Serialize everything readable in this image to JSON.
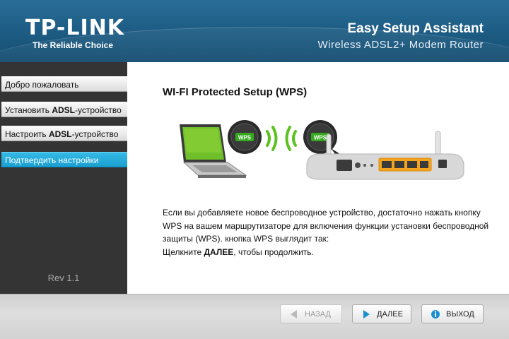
{
  "header": {
    "brand": "TP-LINK",
    "tagline": "The Reliable Choice",
    "title": "Easy Setup Assistant",
    "subtitle": "Wireless ADSL2+ Modem Router"
  },
  "sidebar": {
    "items": [
      {
        "label": "Добро пожаловать",
        "bold": "",
        "active": false
      },
      {
        "label": "Установить ",
        "bold": "ADSL",
        "suffix": "-устройство",
        "active": false
      },
      {
        "label": "Настроить ",
        "bold": "ADSL",
        "suffix": "-устройство",
        "active": false
      },
      {
        "label": "Подтвердить настройки",
        "bold": "",
        "active": true
      }
    ],
    "rev": "Rev 1.1"
  },
  "content": {
    "title": "WI-FI Protected Setup (WPS)",
    "wps_badge": "WPS",
    "desc_line1": "Если вы добавляете новое беспроводное устройство, достаточно нажать кнопку WPS на вашем маршрутизаторе для включения функции установки беспроводной защиты (WPS). кнопка WPS выглядит так:",
    "desc_line2_pre": "Щелкните ",
    "desc_line2_bold": "ДАЛЕЕ",
    "desc_line2_post": ", чтобы продолжить."
  },
  "footer": {
    "back_label": "НАЗАД",
    "next_label": "ДАЛЕЕ",
    "exit_label": "ВЫХОД"
  },
  "icons": {
    "back": "left-triangle-icon",
    "next": "right-triangle-icon",
    "exit": "info-circle-icon"
  },
  "colors": {
    "header": "#1e5e86",
    "active_nav": "#1aa0d2",
    "wps_green": "#33a11b"
  }
}
